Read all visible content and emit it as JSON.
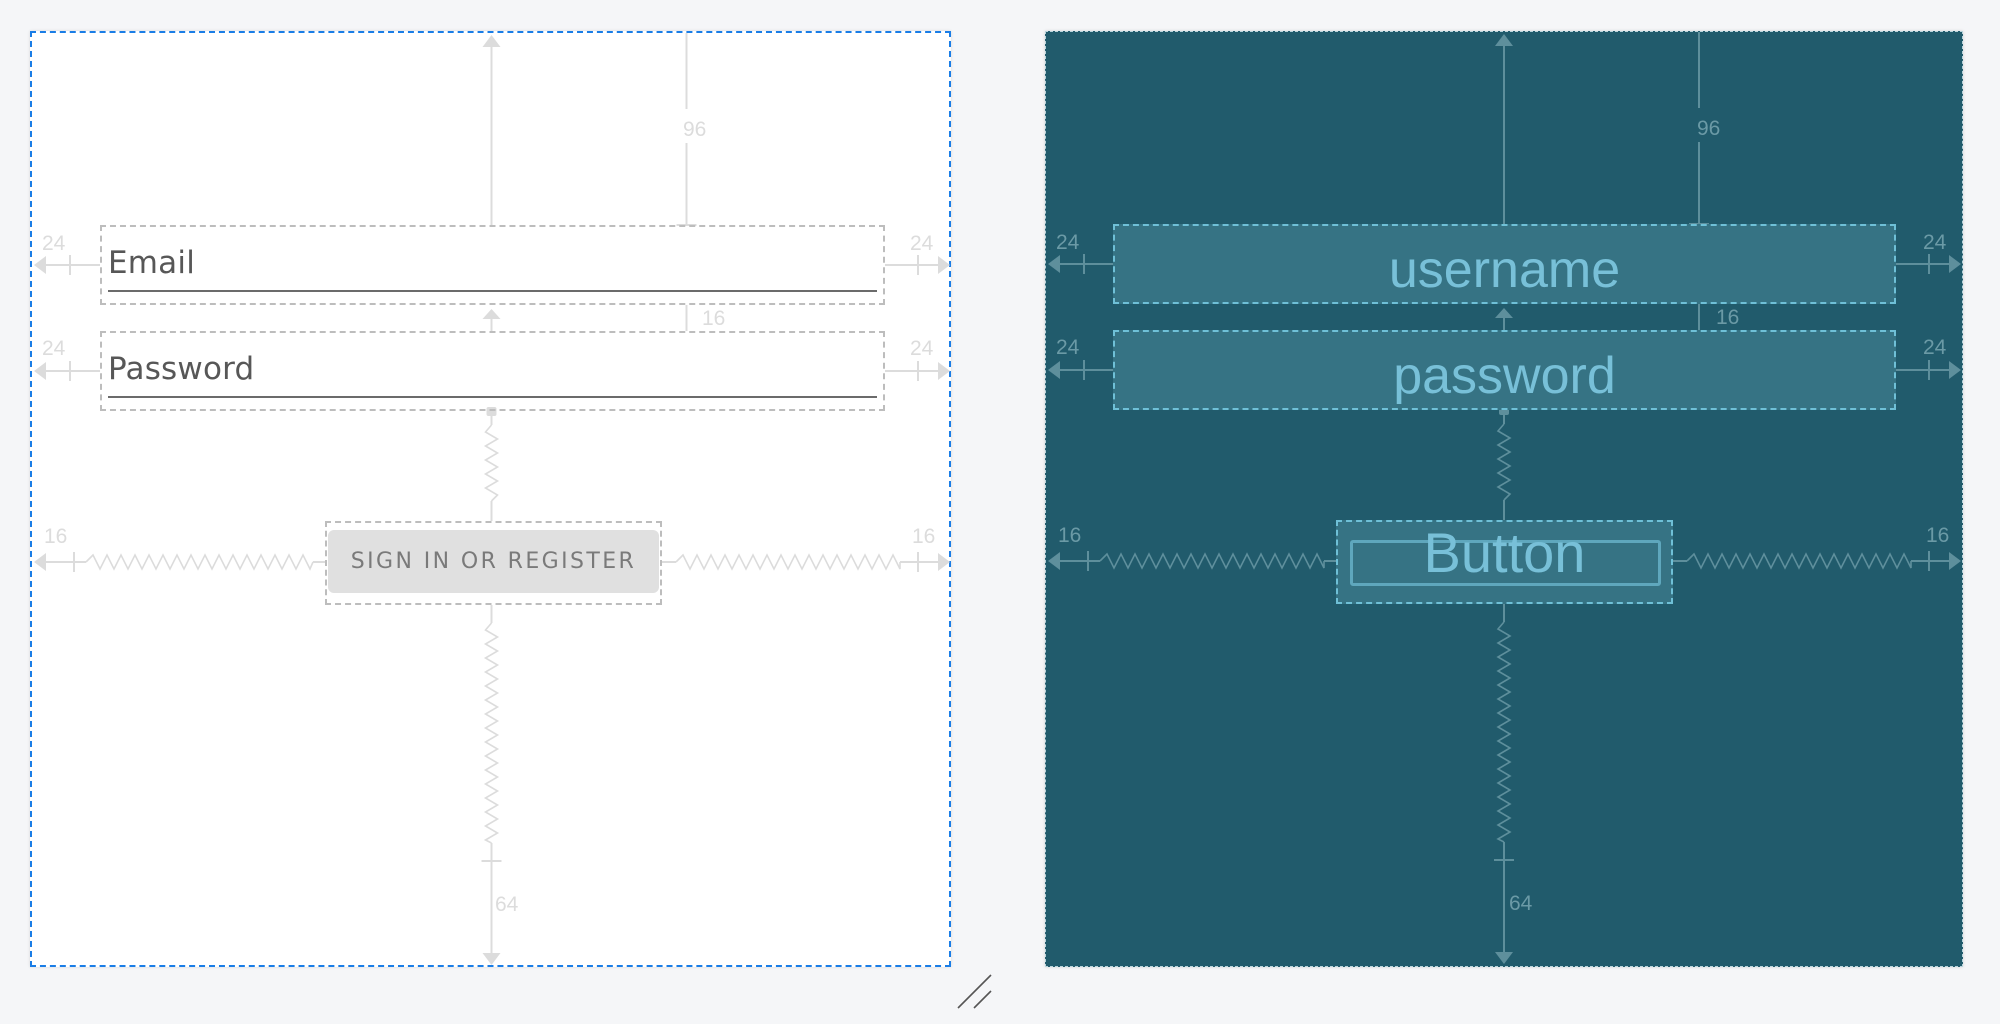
{
  "design_view": {
    "email_field": {
      "hint": "Email"
    },
    "password_field": {
      "hint": "Password"
    },
    "sign_in_button": {
      "label": "SIGN IN OR REGISTER"
    },
    "margins": {
      "top": "96",
      "email_left": "24",
      "email_right": "24",
      "email_password_gap": "16",
      "password_left": "24",
      "password_right": "24",
      "button_left": "16",
      "button_right": "16",
      "bottom": "64"
    }
  },
  "blueprint_view": {
    "username_field": {
      "id_label": "username"
    },
    "password_field": {
      "id_label": "password"
    },
    "button": {
      "label": "Button"
    },
    "margins": {
      "top": "96",
      "username_left": "24",
      "username_right": "24",
      "username_password_gap": "16",
      "password_left": "24",
      "password_right": "24",
      "button_left": "16",
      "button_right": "16",
      "bottom": "64"
    }
  },
  "colors": {
    "selection_border": "#1a7de6",
    "blueprint_background": "#215b6c",
    "blueprint_widget_fill": "#367384",
    "blueprint_text": "#78c0d8",
    "design_constraint": "#dcdcdc",
    "blueprint_constraint": "#6b9aa6"
  }
}
